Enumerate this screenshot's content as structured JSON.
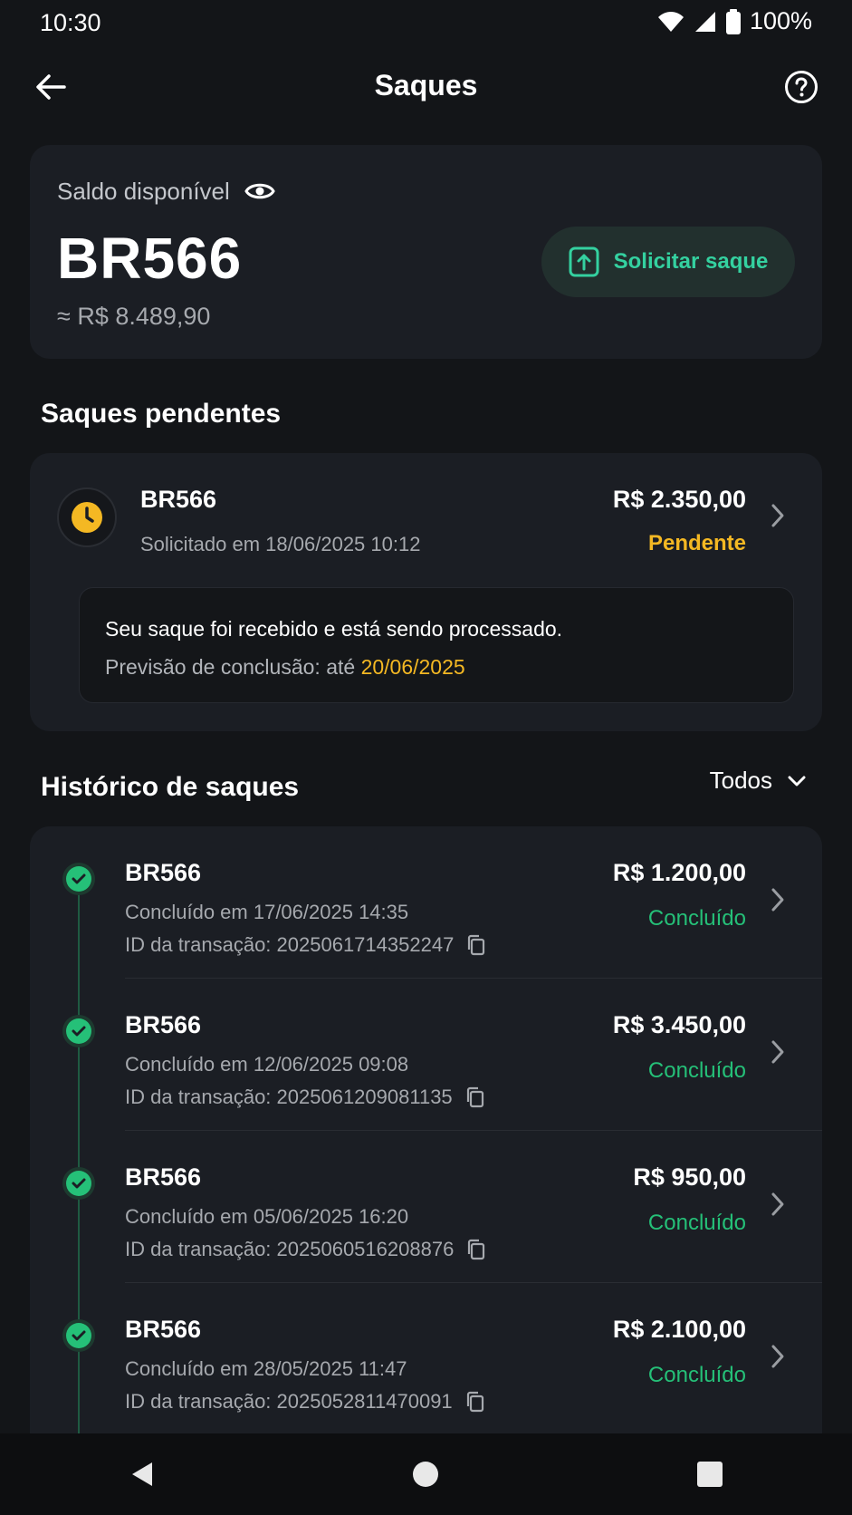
{
  "status_bar": {
    "time": "10:30",
    "battery": "100%"
  },
  "header": {
    "title": "Saques"
  },
  "balance": {
    "label": "Saldo disponível",
    "amount": "BR566",
    "approx": "≈ R$ 8.489,90",
    "withdraw_button": "Solicitar saque"
  },
  "pending": {
    "section_title": "Saques pendentes",
    "item": {
      "name": "BR566",
      "date": "Solicitado em 18/06/2025 10:12",
      "amount": "R$ 2.350,00",
      "status": "Pendente"
    },
    "info_line1": "Seu saque foi recebido e está sendo processado.",
    "info_line2_prefix": "Previsão de conclusão: até ",
    "info_line2_date": "20/06/2025"
  },
  "history": {
    "section_title": "Histórico de saques",
    "filter": "Todos",
    "items": [
      {
        "name": "BR566",
        "date": "Concluído em 17/06/2025 14:35",
        "id": "ID da transação: 2025061714352247",
        "amount": "R$ 1.200,00",
        "status": "Concluído"
      },
      {
        "name": "BR566",
        "date": "Concluído em 12/06/2025 09:08",
        "id": "ID da transação: 2025061209081135",
        "amount": "R$ 3.450,00",
        "status": "Concluído"
      },
      {
        "name": "BR566",
        "date": "Concluído em 05/06/2025 16:20",
        "id": "ID da transação: 2025060516208876",
        "amount": "R$ 950,00",
        "status": "Concluído"
      },
      {
        "name": "BR566",
        "date": "Concluído em 28/05/2025 11:47",
        "id": "ID da transação: 2025052811470091",
        "amount": "R$ 2.100,00",
        "status": "Concluído"
      }
    ]
  },
  "colors": {
    "background": "#131518",
    "card": "#1b1e24",
    "accent_green": "#34d1a0",
    "success": "#25c078",
    "pending": "#f4b823"
  },
  "icons": [
    "back-arrow-icon",
    "help-icon",
    "eye-icon",
    "upload-icon",
    "clock-icon",
    "chevron-right-icon",
    "chevron-down-icon",
    "check-icon",
    "copy-icon",
    "wifi-icon",
    "signal-icon",
    "battery-icon"
  ]
}
